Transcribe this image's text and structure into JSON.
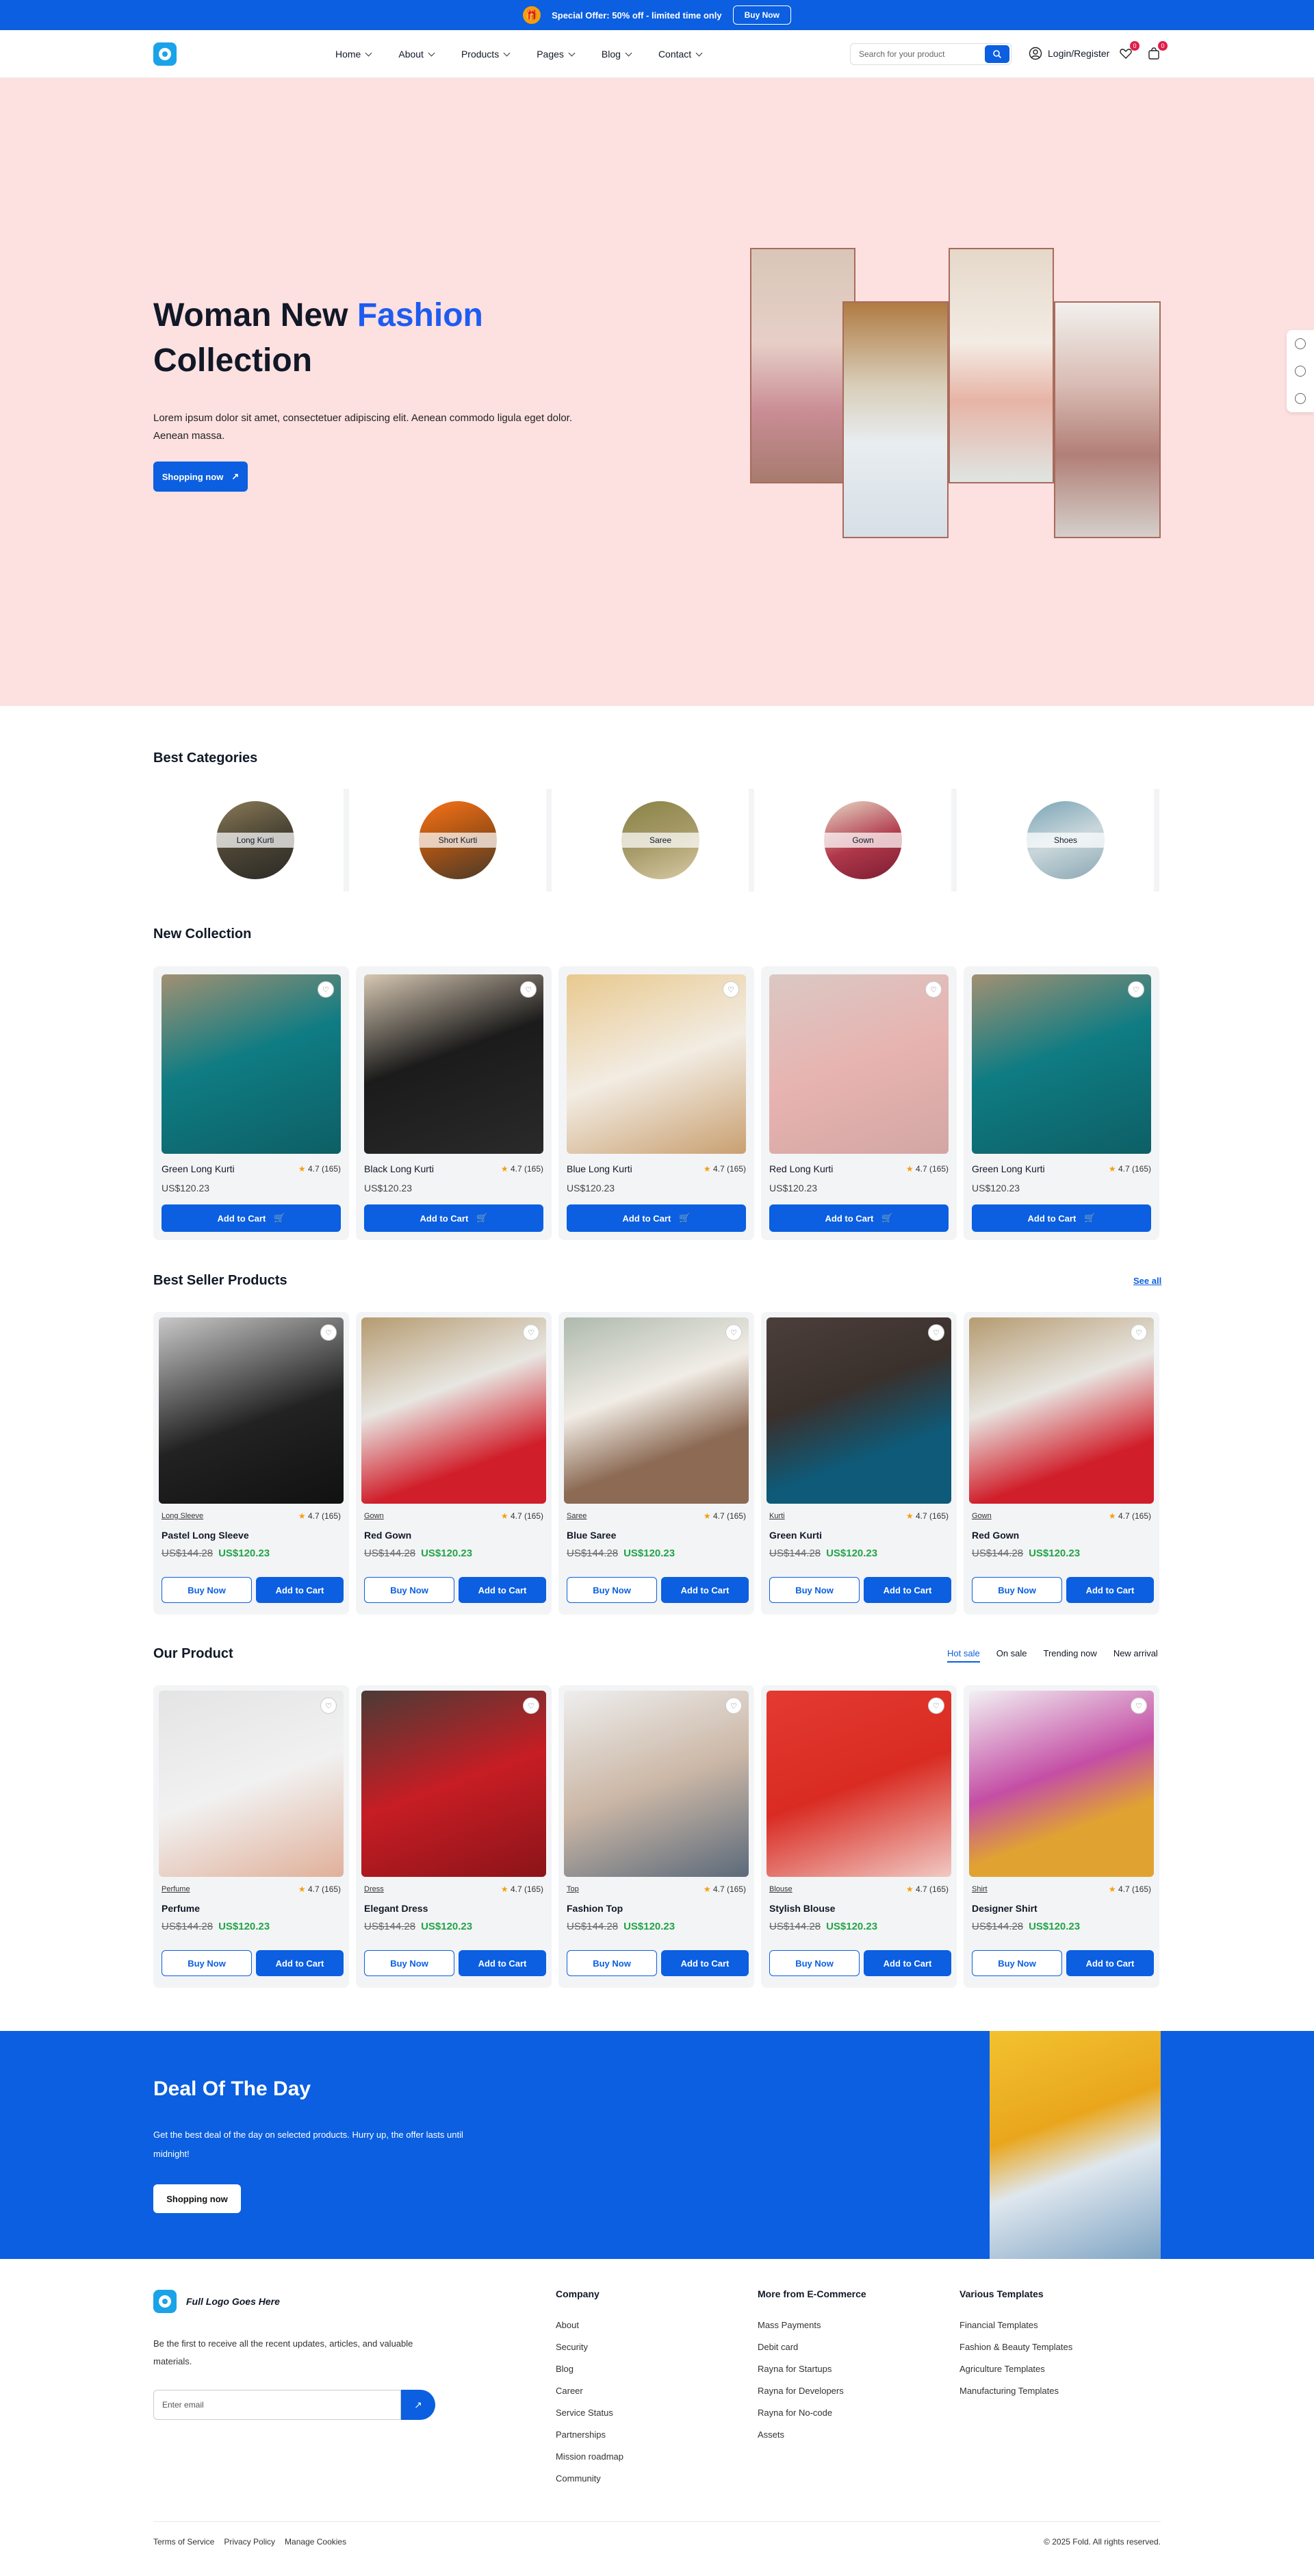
{
  "topbar": {
    "offer": "Special Offer: 50% off - limited time only",
    "cta": "Buy Now"
  },
  "nav": {
    "items": [
      "Home",
      "About",
      "Products",
      "Pages",
      "Blog",
      "Contact"
    ],
    "search_placeholder": "Search for your product",
    "login": "Login/Register",
    "wishlist_count": "0",
    "cart_count": "0"
  },
  "hero": {
    "title_a": "Woman New ",
    "title_accent": "Fashion",
    "title_b": "Collection",
    "desc": "Lorem ipsum dolor sit amet, consectetuer adipiscing elit. Aenean commodo ligula eget dolor. Aenean massa.",
    "cta": "Shopping now"
  },
  "categories": {
    "title": "Best Categories",
    "items": [
      "Long Kurti",
      "Short Kurti",
      "Saree",
      "Gown",
      "Shoes"
    ]
  },
  "new_collection": {
    "title": "New Collection",
    "items": [
      {
        "name": "Green Long Kurti",
        "rating": "4.7 (165)",
        "price": "US$120.23",
        "cta": "Add to Cart"
      },
      {
        "name": "Black Long Kurti",
        "rating": "4.7 (165)",
        "price": "US$120.23",
        "cta": "Add to Cart"
      },
      {
        "name": "Blue Long Kurti",
        "rating": "4.7 (165)",
        "price": "US$120.23",
        "cta": "Add to Cart"
      },
      {
        "name": "Red Long Kurti",
        "rating": "4.7 (165)",
        "price": "US$120.23",
        "cta": "Add to Cart"
      },
      {
        "name": "Green Long Kurti",
        "rating": "4.7 (165)",
        "price": "US$120.23",
        "cta": "Add to Cart"
      }
    ]
  },
  "best_seller": {
    "title": "Best Seller Products",
    "see_all": "See all",
    "items": [
      {
        "tag": "Long Sleeve",
        "name": "Pastel Long Sleeve",
        "rating": "4.7 (165)",
        "old": "US$144.28",
        "new": "US$120.23",
        "buy": "Buy Now",
        "add": "Add to Cart"
      },
      {
        "tag": "Gown",
        "name": "Red Gown",
        "rating": "4.7 (165)",
        "old": "US$144.28",
        "new": "US$120.23",
        "buy": "Buy Now",
        "add": "Add to Cart"
      },
      {
        "tag": "Saree",
        "name": "Blue Saree",
        "rating": "4.7 (165)",
        "old": "US$144.28",
        "new": "US$120.23",
        "buy": "Buy Now",
        "add": "Add to Cart"
      },
      {
        "tag": "Kurti",
        "name": "Green Kurti",
        "rating": "4.7 (165)",
        "old": "US$144.28",
        "new": "US$120.23",
        "buy": "Buy Now",
        "add": "Add to Cart"
      },
      {
        "tag": "Gown",
        "name": "Red Gown",
        "rating": "4.7 (165)",
        "old": "US$144.28",
        "new": "US$120.23",
        "buy": "Buy Now",
        "add": "Add to Cart"
      }
    ]
  },
  "our_product": {
    "title": "Our Product",
    "tabs": [
      "Hot sale",
      "On sale",
      "Trending now",
      "New arrival"
    ],
    "items": [
      {
        "tag": "Perfume",
        "name": "Perfume",
        "rating": "4.7 (165)",
        "old": "US$144.28",
        "new": "US$120.23",
        "buy": "Buy Now",
        "add": "Add to Cart"
      },
      {
        "tag": "Dress",
        "name": "Elegant Dress",
        "rating": "4.7 (165)",
        "old": "US$144.28",
        "new": "US$120.23",
        "buy": "Buy Now",
        "add": "Add to Cart"
      },
      {
        "tag": "Top",
        "name": "Fashion Top",
        "rating": "4.7 (165)",
        "old": "US$144.28",
        "new": "US$120.23",
        "buy": "Buy Now",
        "add": "Add to Cart"
      },
      {
        "tag": "Blouse",
        "name": "Stylish Blouse",
        "rating": "4.7 (165)",
        "old": "US$144.28",
        "new": "US$120.23",
        "buy": "Buy Now",
        "add": "Add to Cart"
      },
      {
        "tag": "Shirt",
        "name": "Designer Shirt",
        "rating": "4.7 (165)",
        "old": "US$144.28",
        "new": "US$120.23",
        "buy": "Buy Now",
        "add": "Add to Cart"
      }
    ]
  },
  "deal": {
    "title": "Deal Of The Day",
    "desc": "Get the best deal of the day on selected products. Hurry up, the offer lasts until midnight!",
    "cta": "Shopping now"
  },
  "footer": {
    "logo": "Full Logo Goes Here",
    "text": "Be the first to receive all the recent updates, articles, and valuable materials.",
    "email_placeholder": "Enter email",
    "company": {
      "title": "Company",
      "links": [
        "About",
        "Security",
        "Blog",
        "Career",
        "Service Status",
        "Partnerships",
        "Mission roadmap",
        "Community"
      ]
    },
    "more": {
      "title": "More from E-Commerce",
      "links": [
        "Mass Payments",
        "Debit card",
        "Rayna for Startups",
        "Rayna for Developers",
        "Rayna for No-code",
        "Assets"
      ]
    },
    "templates": {
      "title": "Various Templates",
      "links": [
        "Financial Templates",
        "Fashion & Beauty Templates",
        "Agriculture Templates",
        "Manufacturing Templates"
      ]
    },
    "bottom_links": [
      "Terms of Service",
      "Privacy Policy",
      "Manage Cookies"
    ],
    "copyright": "© 2025 Fold. All rights reserved."
  },
  "colors": {
    "primary": "#0b5fe0",
    "hero_bg": "#fde0e0",
    "accent": "#1d5cf0",
    "discount": "#22a447"
  }
}
